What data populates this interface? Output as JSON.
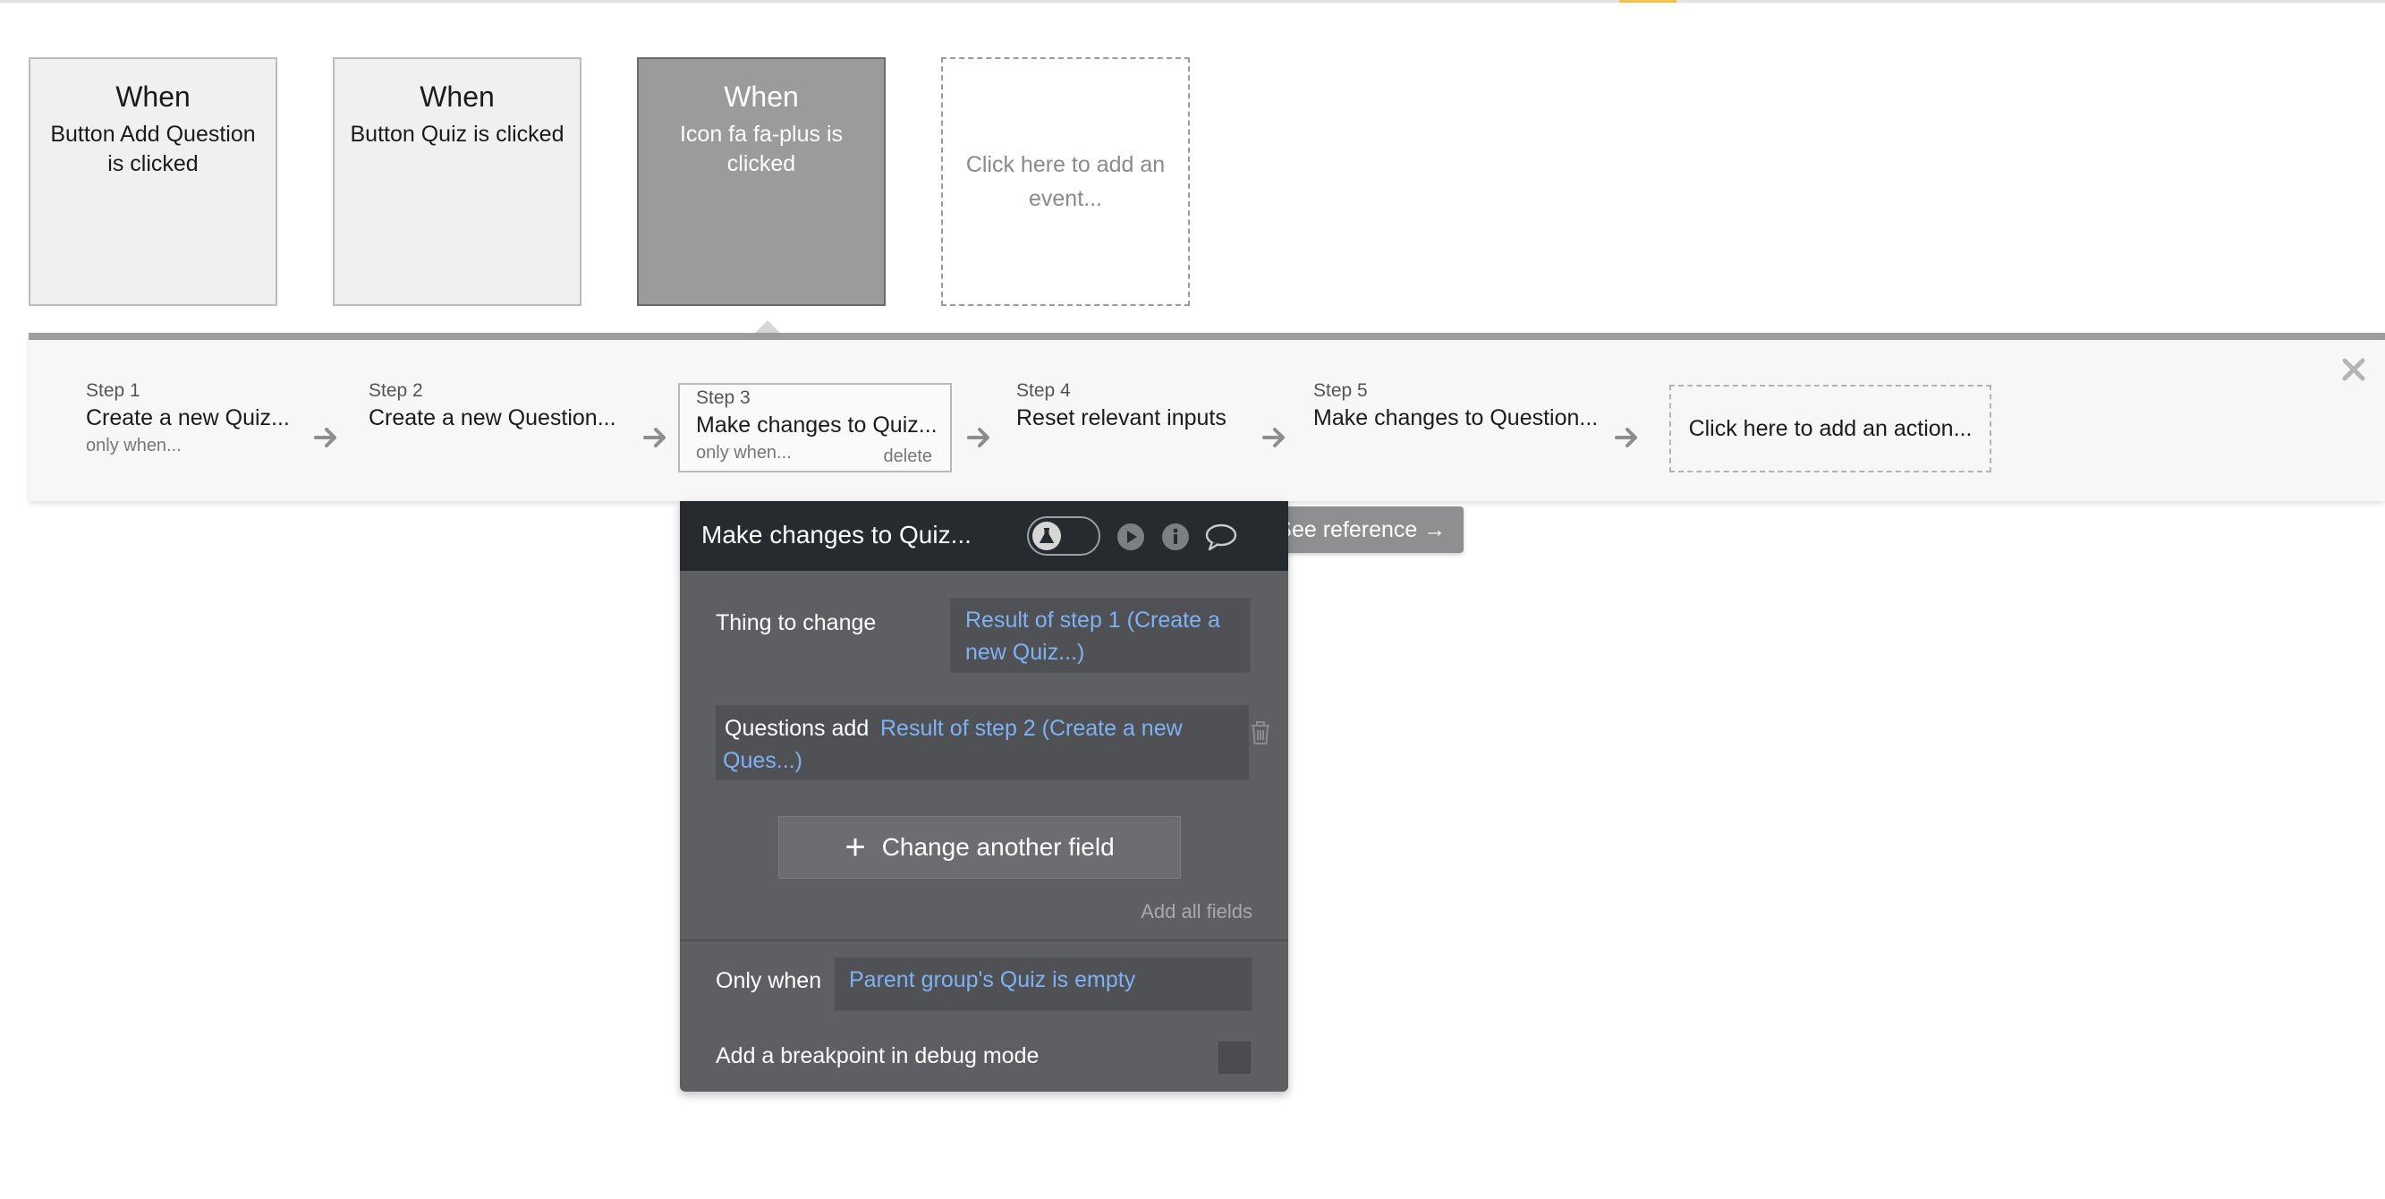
{
  "events": [
    {
      "when": "When",
      "description": "Button Add Question is clicked"
    },
    {
      "when": "When",
      "description": "Button Quiz is clicked"
    },
    {
      "when": "When",
      "description": "Icon fa fa-plus is clicked"
    }
  ],
  "add_event_label": "Click here to add an event...",
  "steps": [
    {
      "number": "Step 1",
      "name": "Create a new Quiz...",
      "condition": "only when..."
    },
    {
      "number": "Step 2",
      "name": "Create a new Question...",
      "condition": ""
    },
    {
      "number": "Step 3",
      "name": "Make changes to Quiz...",
      "condition": "only when...",
      "delete": "delete"
    },
    {
      "number": "Step 4",
      "name": "Reset relevant inputs",
      "condition": ""
    },
    {
      "number": "Step 5",
      "name": "Make changes to Question...",
      "condition": ""
    }
  ],
  "add_action_label": "Click here to add an action...",
  "panel": {
    "title": "Make changes to Quiz...",
    "see_reference": "See reference →",
    "help_glyph": "?",
    "thing_to_change_label": "Thing to change",
    "thing_to_change_value": "Result of step 1 (Create a new Quiz...)",
    "field_label": "Questions add",
    "field_value": "Result of step 2 (Create a new Ques...)",
    "change_another_field": "Change another field",
    "add_all_fields": "Add all fields",
    "only_when_label": "Only when",
    "only_when_value": "Parent group's Quiz is empty",
    "breakpoint_label": "Add a breakpoint in debug mode"
  },
  "icons": [
    "flask-icon",
    "play-icon",
    "info-icon",
    "comment-icon",
    "trash-icon",
    "close-icon",
    "arrow-right-icon",
    "plus-icon"
  ],
  "colors": {
    "header": "#262b2f",
    "panel": "#5d5f62",
    "link": "#7fb1f5",
    "selected_event": "#9b9b9b",
    "accent": "#f2c14e"
  }
}
